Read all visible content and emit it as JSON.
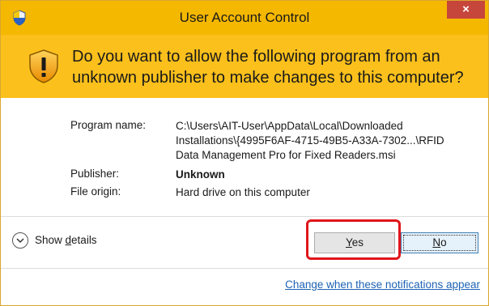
{
  "window": {
    "title": "User Account Control",
    "close_label": "×"
  },
  "header": {
    "question": "Do you want to allow the following program from an unknown publisher to make changes to this computer?"
  },
  "details": {
    "program_name_label": "Program name:",
    "program_name_line1": "C:\\Users\\AIT-User\\AppData\\Local\\Downloaded",
    "program_name_line2": "Installations\\{4995F6AF-4715-49B5-A33A-7302...\\RFID",
    "program_name_line3": "Data Management Pro for Fixed Readers.msi",
    "publisher_label": "Publisher:",
    "publisher_value": "Unknown",
    "file_origin_label": "File origin:",
    "file_origin_value": "Hard drive on this computer"
  },
  "footer": {
    "show_details_prefix": "Show ",
    "show_details_accel": "d",
    "show_details_suffix": "etails",
    "yes_accel": "Y",
    "yes_rest": "es",
    "no_accel": "N",
    "no_rest": "o",
    "change_link": "Change when these notifications appear"
  },
  "icons": {
    "title_icon": "uac-shield-icon",
    "header_icon": "warning-shield-icon",
    "expand_icon": "chevron-down-icon"
  },
  "colors": {
    "titlebar": "#f5b800",
    "header": "#fbc01c",
    "close_button": "#c7463b",
    "highlight": "#e0161b",
    "link": "#1e63b4"
  }
}
